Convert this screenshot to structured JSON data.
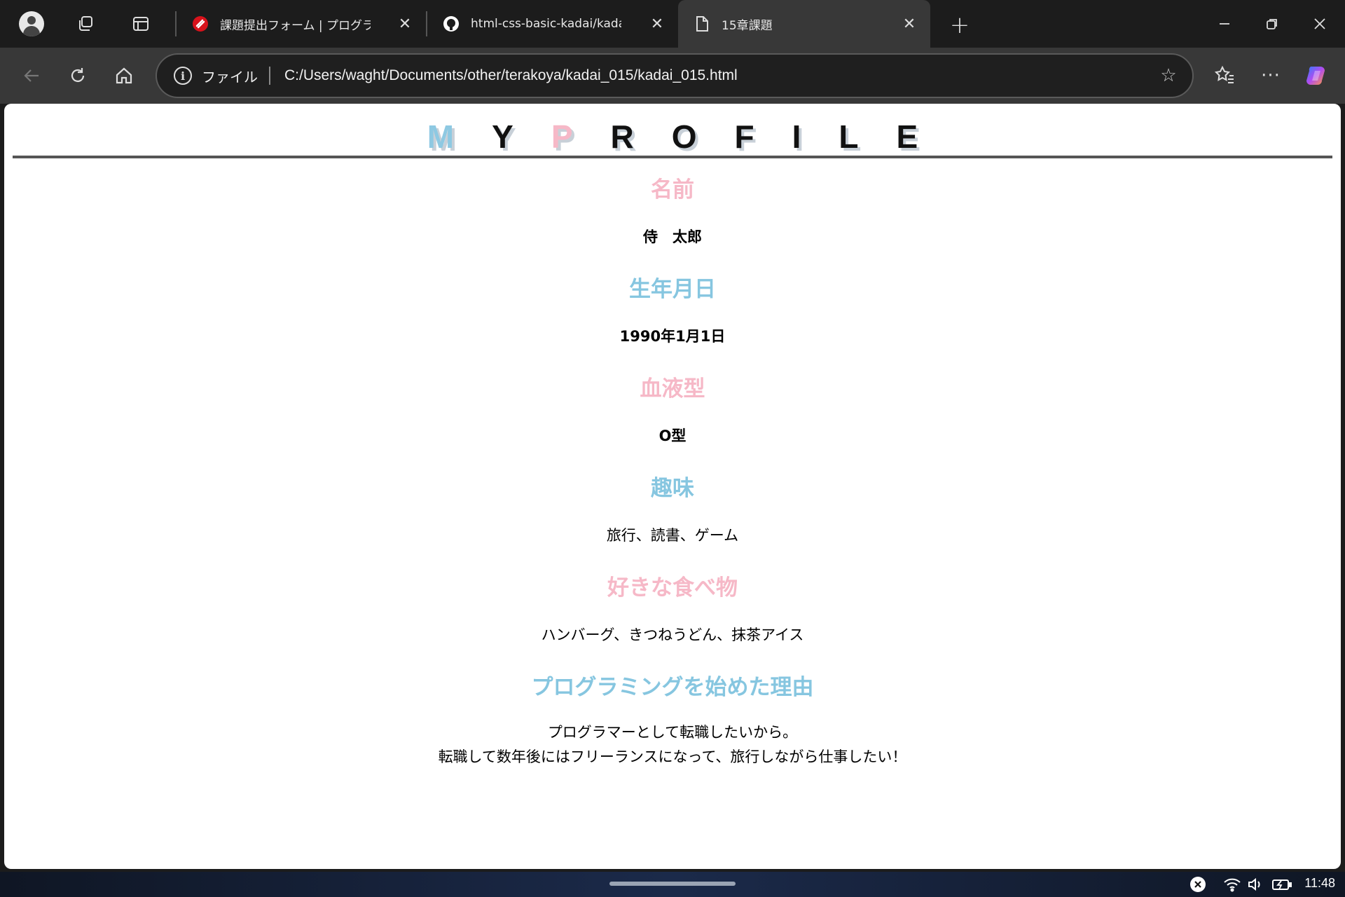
{
  "browser": {
    "tabs": [
      {
        "title": "課題提出フォーム | プログラミング",
        "icon": "samurai-logo-icon",
        "active": false
      },
      {
        "title": "html-css-basic-kadai/kadai_",
        "icon": "github-icon",
        "active": false
      },
      {
        "title": "15章課題",
        "icon": "document-icon",
        "active": true
      }
    ],
    "address": {
      "scheme_label": "ファイル",
      "url": "C:/Users/waght/Documents/other/terakoya/kadai_015/kadai_015.html"
    }
  },
  "page": {
    "logo_letters": [
      {
        "ch": "M",
        "color": "blue"
      },
      {
        "ch": "Y",
        "color": "black"
      },
      {
        "ch": "P",
        "color": "pink"
      },
      {
        "ch": "R",
        "color": "black"
      },
      {
        "ch": "O",
        "color": "black"
      },
      {
        "ch": "F",
        "color": "black"
      },
      {
        "ch": "I",
        "color": "black"
      },
      {
        "ch": "L",
        "color": "black"
      },
      {
        "ch": "E",
        "color": "black"
      }
    ],
    "sections": {
      "name": {
        "heading": "名前",
        "value": "侍　太郎"
      },
      "birthday": {
        "heading": "生年月日",
        "value": "1990年1月1日"
      },
      "blood": {
        "heading": "血液型",
        "value": "O型"
      },
      "hobby": {
        "heading": "趣味",
        "value": "旅行、読書、ゲーム"
      },
      "food": {
        "heading": "好きな食べ物",
        "value": "ハンバーグ、きつねうどん、抹茶アイス"
      },
      "reason": {
        "heading": "プログラミングを始めた理由",
        "line1": "プログラマーとして転職したいから。",
        "line2": "転職して数年後にはフリーランスになって、旅行しながら仕事したい！"
      }
    },
    "colors": {
      "pink": "#f6b8c7",
      "blue": "#86c6e0"
    }
  },
  "taskbar": {
    "time": "11:48"
  }
}
